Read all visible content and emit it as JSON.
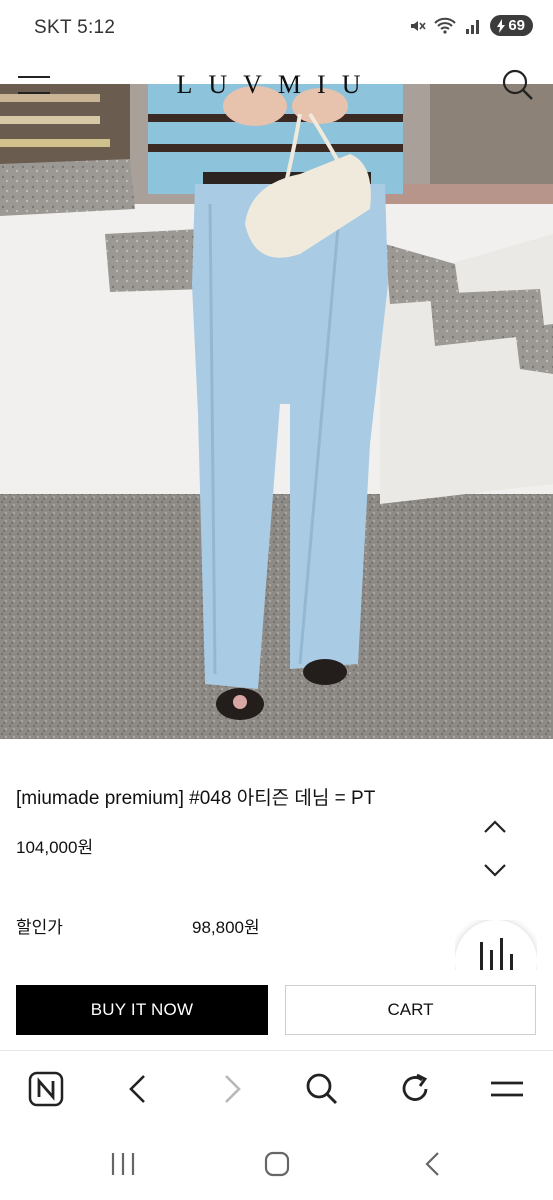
{
  "status_bar": {
    "carrier_time": "SKT 5:12",
    "battery": "69"
  },
  "header": {
    "brand": "LUVMIU"
  },
  "product": {
    "title": "[miumade premium] #048 아티즌 데님 = PT",
    "price": "104,000원",
    "sale_label": "할인가",
    "sale_price": "98,800원"
  },
  "actions": {
    "buy_now": "BUY IT NOW",
    "cart": "CART"
  },
  "colors": {
    "primary_button": "#000000",
    "page_bg": "#ffffff",
    "jeans": "#a9cbe4"
  },
  "icons": {
    "header": [
      "hamburger-menu-icon",
      "search-icon"
    ],
    "browser": [
      "naver-icon",
      "back-arrow-icon",
      "forward-arrow-icon",
      "search-icon",
      "refresh-icon",
      "menu-icon"
    ],
    "system": [
      "recent-apps-icon",
      "home-icon",
      "back-icon"
    ]
  }
}
